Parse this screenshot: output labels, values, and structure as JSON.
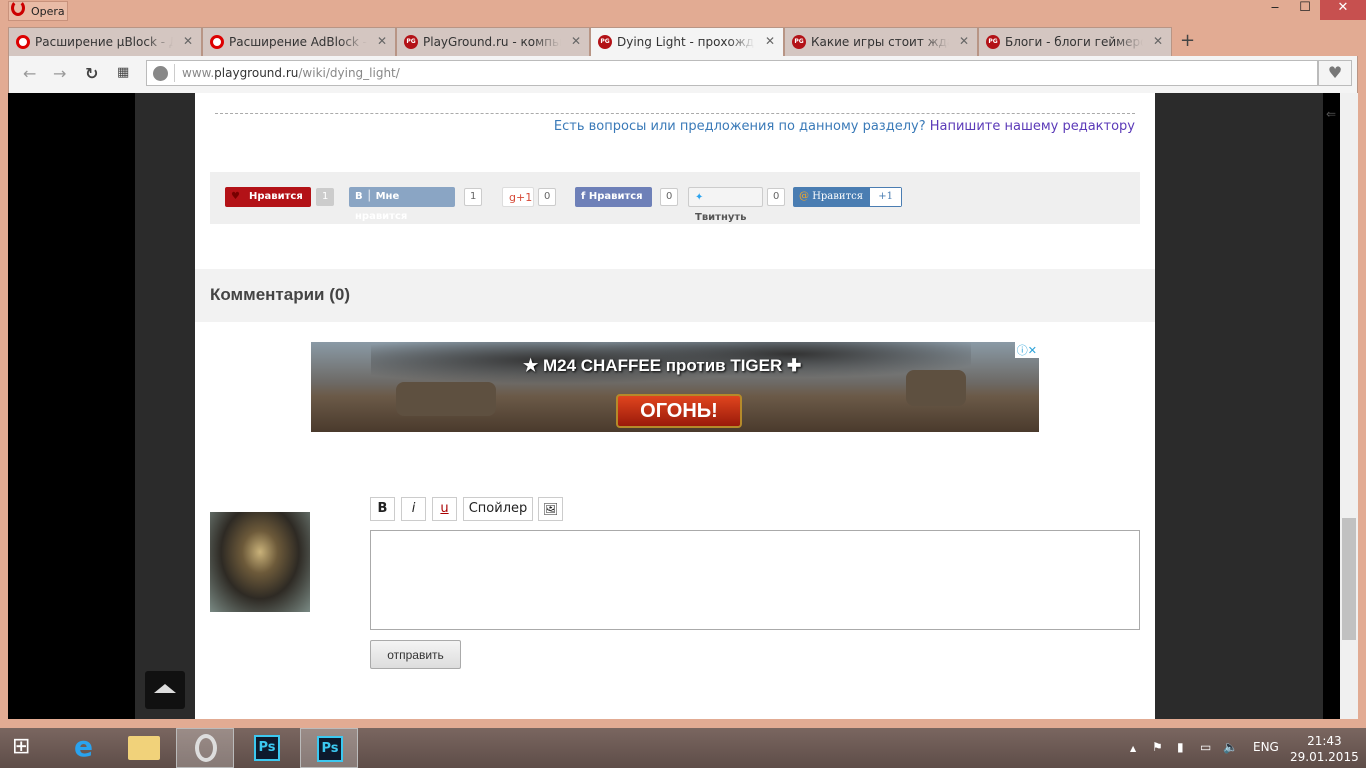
{
  "window": {
    "app_name": "Opera",
    "minimize": "‒",
    "maximize": "☐",
    "close": "✕"
  },
  "tabs": [
    {
      "title": "Расширение µBlock - Доп",
      "icon": "opera-icon"
    },
    {
      "title": "Расширение AdBlock - До",
      "icon": "opera-icon"
    },
    {
      "title": "PlayGround.ru - компьюте",
      "icon": "pg-icon"
    },
    {
      "title": "Dying Light - прохождени",
      "icon": "pg-icon",
      "active": true
    },
    {
      "title": "Какие игры стоит ждать в",
      "icon": "pg-icon"
    },
    {
      "title": "Блоги - блоги геймеров, ",
      "icon": "pg-icon"
    }
  ],
  "fav_label": "PG",
  "close_glyph": "✕",
  "new_tab": "+",
  "address": {
    "prefix": "www.",
    "domain": "playground.ru",
    "path": "/wiki/dying_light/"
  },
  "page": {
    "question": "Есть вопросы или предложения по данному разделу?",
    "question_link": "Напишите нашему редактору",
    "social": {
      "pg_like": "Нравится",
      "pg_count": "1",
      "vk_b": "В",
      "vk_like": "Мне нравится",
      "vk_count": "1",
      "gplus": "g+1",
      "gplus_count": "0",
      "fb_like": "Нравится",
      "fb_count": "0",
      "tw": "Твитнуть",
      "tw_count": "0",
      "mail_like": "Нравится",
      "mail_count": "+1"
    },
    "comments_title": "Комментарии (0)",
    "ad": {
      "headline": "★ M24 CHAFFEE против TIGER ✚",
      "cta": "ОГОНЬ!",
      "adchoices": "ⓘ✕"
    },
    "editor": {
      "bold": "B",
      "italic": "i",
      "underline": "u",
      "spoiler": "Спойлер",
      "image": "🖼",
      "textarea_value": "",
      "send": "отправить"
    }
  },
  "taskbar": {
    "ps": "Ps",
    "lang": "ENG",
    "time": "21:43",
    "date": "29.01.2015"
  },
  "colors": {
    "frame": "#e2ab93",
    "pg_red": "#b31217",
    "vk": "#8aa5c4",
    "fb": "#6e80b8",
    "mail": "#4a7db2",
    "link": "#3a7ab8"
  }
}
